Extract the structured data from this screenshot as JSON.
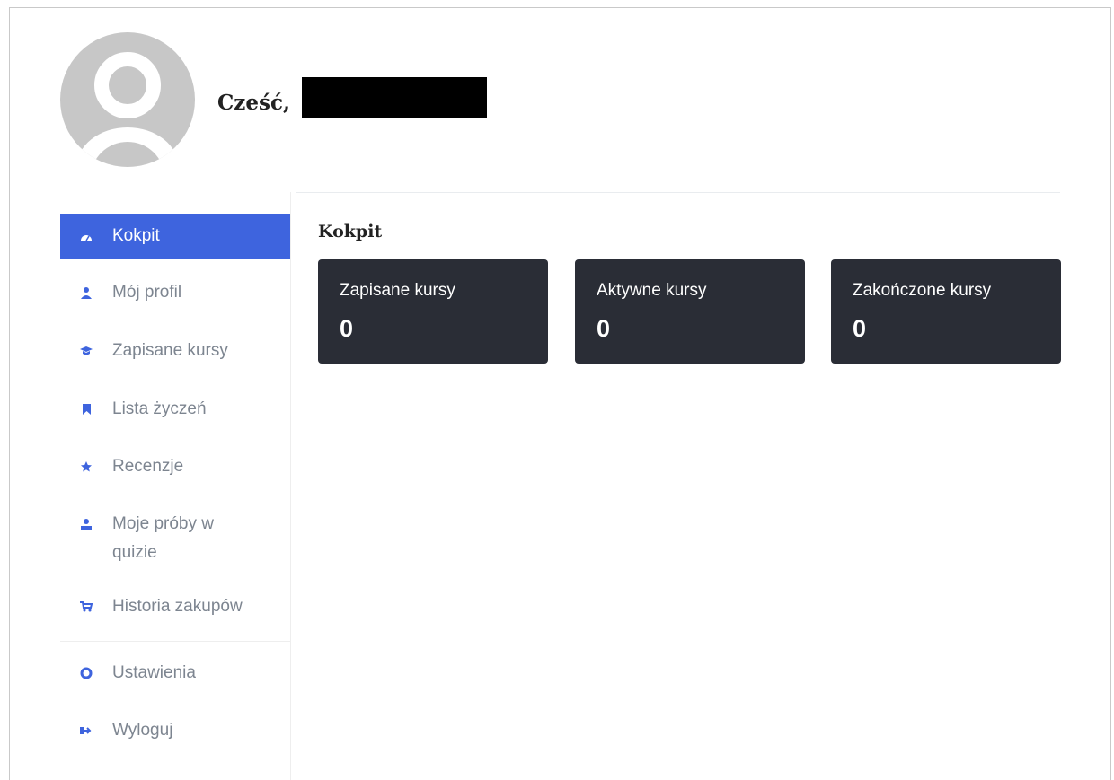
{
  "header": {
    "greeting": "Cześć,"
  },
  "sidebar": {
    "items": [
      {
        "label": "Kokpit",
        "icon": "dashboard-icon",
        "active": true
      },
      {
        "label": "Mój profil",
        "icon": "user-icon"
      },
      {
        "label": "Zapisane kursy",
        "icon": "graduation-cap-icon"
      },
      {
        "label": "Lista życzeń",
        "icon": "bookmark-icon"
      },
      {
        "label": "Recenzje",
        "icon": "star-review-icon"
      },
      {
        "label": "Moje próby w quizie",
        "icon": "quiz-attempts-icon"
      },
      {
        "label": "Historia zakupów",
        "icon": "cart-icon"
      },
      {
        "label": "Ustawienia",
        "icon": "gear-icon"
      },
      {
        "label": "Wyloguj",
        "icon": "logout-icon"
      }
    ]
  },
  "main": {
    "title": "Kokpit",
    "cards": [
      {
        "label": "Zapisane kursy",
        "value": "0"
      },
      {
        "label": "Aktywne kursy",
        "value": "0"
      },
      {
        "label": "Zakończone kursy",
        "value": "0"
      }
    ]
  },
  "colors": {
    "accent": "#3e64de",
    "card_bg": "#2a2d36",
    "sidebar_text": "#7d8590"
  }
}
